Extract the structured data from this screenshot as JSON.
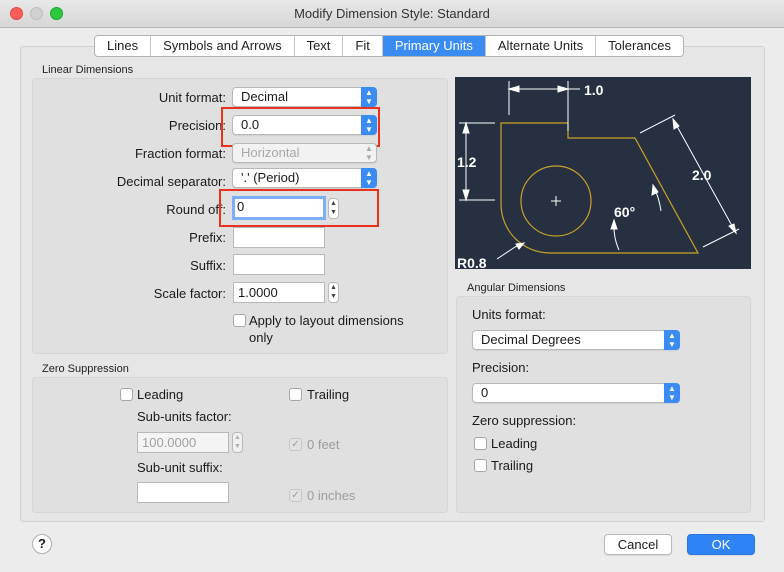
{
  "window": {
    "title": "Modify Dimension Style: Standard"
  },
  "tabs": [
    "Lines",
    "Symbols and Arrows",
    "Text",
    "Fit",
    "Primary Units",
    "Alternate Units",
    "Tolerances"
  ],
  "active_tab": "Primary Units",
  "linear": {
    "group_label": "Linear Dimensions",
    "unit_format_label": "Unit format:",
    "unit_format_value": "Decimal",
    "precision_label": "Precision:",
    "precision_value": "0.0",
    "fraction_format_label": "Fraction format:",
    "fraction_format_value": "Horizontal",
    "decimal_separator_label": "Decimal separator:",
    "decimal_separator_value": "'.' (Period)",
    "round_off_label": "Round off:",
    "round_off_value": "0",
    "prefix_label": "Prefix:",
    "prefix_value": "",
    "suffix_label": "Suffix:",
    "suffix_value": "",
    "scale_factor_label": "Scale factor:",
    "scale_factor_value": "1.0000",
    "apply_layout_line1": "Apply to layout dimensions",
    "apply_layout_line2": "only"
  },
  "zero_suppression": {
    "group_label": "Zero Suppression",
    "leading_label": "Leading",
    "trailing_label": "Trailing",
    "sub_units_factor_label": "Sub-units factor:",
    "sub_units_factor_value": "100.0000",
    "sub_unit_suffix_label": "Sub-unit suffix:",
    "sub_unit_suffix_value": "",
    "zero_feet_label": "0 feet",
    "zero_inches_label": "0 inches"
  },
  "preview": {
    "dim_top": "1.0",
    "dim_left": "1.2",
    "dim_right": "2.0",
    "dim_angle": "60°",
    "dim_radius": "R0.8",
    "background": "#263040",
    "line_color": "#c9a227"
  },
  "angular": {
    "group_label": "Angular Dimensions",
    "units_format_label": "Units format:",
    "units_format_value": "Decimal Degrees",
    "precision_label": "Precision:",
    "precision_value": "0",
    "zero_suppression_label": "Zero suppression:",
    "leading_label": "Leading",
    "trailing_label": "Trailing"
  },
  "buttons": {
    "help": "?",
    "cancel": "Cancel",
    "ok": "OK"
  },
  "colors": {
    "accent": "#3a8cf2",
    "highlight": "#e8321e"
  }
}
